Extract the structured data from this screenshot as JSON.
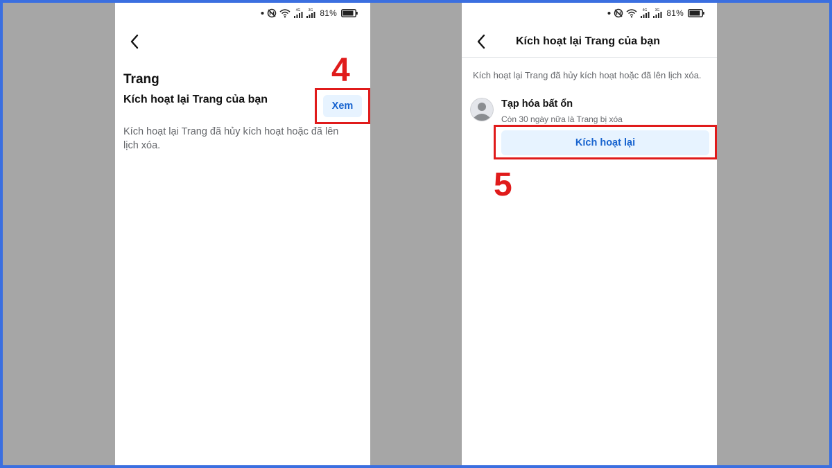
{
  "colors": {
    "background": "#a6a6a6",
    "frame_border": "#3b6fe0",
    "highlight": "#e01b1b",
    "button_bg": "#e7f3ff",
    "button_text": "#1763cf"
  },
  "status_bar": {
    "battery_percent": "81%",
    "network_label_1": "4G",
    "network_label_2": "3G"
  },
  "left_screen": {
    "back_icon": "chevron-left-icon",
    "section_title": "Trang",
    "item_title": "Kích hoạt lại Trang của bạn",
    "view_button_label": "Xem",
    "description": "Kích hoạt lại Trang đã hủy kích hoạt hoặc đã lên lịch xóa."
  },
  "right_screen": {
    "back_icon": "chevron-left-icon",
    "header_title": "Kích hoạt lại Trang của bạn",
    "description": "Kích hoạt lại Trang đã hủy kích hoạt hoặc đã lên lịch xóa.",
    "page": {
      "avatar_icon": "default-avatar-icon",
      "name": "Tạp hóa bất ổn",
      "status": "Còn 30 ngày nữa là Trang bị xóa",
      "reactivate_label": "Kích hoạt lại"
    }
  },
  "annotations": {
    "step_4": "4",
    "step_5": "5"
  }
}
